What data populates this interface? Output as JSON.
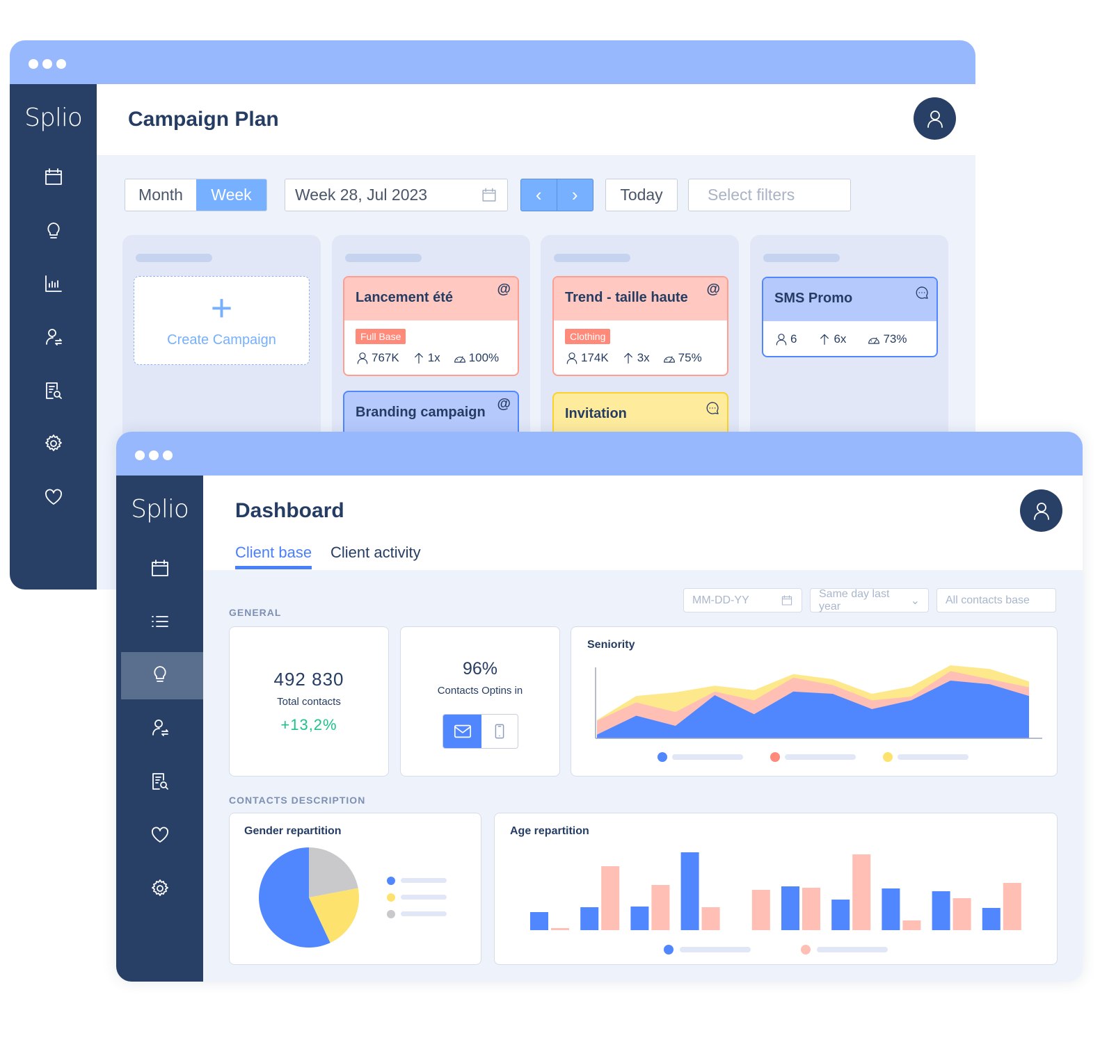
{
  "colors": {
    "navy": "#283f66",
    "titlebar": "#98b8fd",
    "accent": "#5087fe",
    "pink": "#ffbfb5",
    "yellow": "#fde98c",
    "green": "#1ec28b",
    "tag": "#ff8a7a"
  },
  "campaign_window": {
    "logo": "Splio",
    "sidebar_icons": [
      "calendar-icon",
      "lightbulb-icon",
      "bar-chart-icon",
      "user-sync-icon",
      "report-search-icon",
      "gear-icon",
      "heart-icon"
    ],
    "title": "Campaign Plan",
    "view_toggle": {
      "month": "Month",
      "week": "Week",
      "selected": "Week"
    },
    "week_field": "Week 28, Jul 2023",
    "today": "Today",
    "filters_placeholder": "Select filters",
    "create_campaign": "Create Campaign",
    "cards": [
      {
        "title": "Lancement été",
        "channel": "email",
        "tag": "Full Base",
        "audience": "767K",
        "multiplier": "1x",
        "score": "100%"
      },
      {
        "title": "Branding campaign",
        "channel": "email"
      },
      {
        "title": "Trend - taille haute",
        "channel": "email",
        "tag": "Clothing",
        "audience": "174K",
        "multiplier": "3x",
        "score": "75%"
      },
      {
        "title": "Invitation",
        "channel": "sms"
      },
      {
        "title": "SMS Promo",
        "channel": "sms",
        "audience": "6",
        "multiplier": "6x",
        "score": "73%"
      }
    ]
  },
  "dashboard_window": {
    "logo": "Splio",
    "sidebar_icons": [
      "calendar-icon",
      "list-icon",
      "lightbulb-icon",
      "user-sync-icon",
      "report-search-icon",
      "heart-icon",
      "gear-icon"
    ],
    "active_sidebar": "lightbulb-icon",
    "title": "Dashboard",
    "tabs": [
      {
        "label": "Client base",
        "active": true
      },
      {
        "label": "Client activity",
        "active": false
      }
    ],
    "filters": {
      "date_placeholder": "MM-DD-YY",
      "compare": "Same day last year",
      "base": "All contacts base"
    },
    "general_label": "GENERAL",
    "total_contacts": {
      "value": "492 830",
      "label": "Total contacts",
      "change": "+13,2%"
    },
    "optins": {
      "value": "96%",
      "label": "Contacts Optins in",
      "selected_channel": "email"
    },
    "contacts_description_label": "CONTACTS DESCRIPTION"
  },
  "chart_data": [
    {
      "type": "area",
      "title": "Seniority",
      "stacked": true,
      "grid": false,
      "series": [
        {
          "color": "#5087fe",
          "values": [
            5,
            31,
            17,
            59,
            33,
            64,
            61,
            40,
            52,
            79,
            74,
            58
          ]
        },
        {
          "color": "#ffbfb5",
          "values": [
            24,
            49,
            36,
            64,
            52,
            83,
            73,
            52,
            57,
            92,
            81,
            70
          ]
        },
        {
          "color": "#fde98c",
          "values": [
            25,
            58,
            63,
            72,
            66,
            88,
            81,
            61,
            71,
            100,
            95,
            78
          ]
        }
      ]
    },
    {
      "type": "pie",
      "title": "Gender repartition",
      "slices": [
        {
          "color": "#c9c9cc",
          "value": 22
        },
        {
          "color": "#fde26e",
          "value": 21
        },
        {
          "color": "#5087fe",
          "value": 57
        }
      ]
    },
    {
      "type": "bar",
      "title": "Age repartition",
      "series": [
        {
          "color": "#5087fe",
          "values": [
            26,
            33,
            34,
            112,
            0,
            63,
            44,
            60,
            56,
            32
          ]
        },
        {
          "color": "#ffbfb5",
          "values": [
            3,
            92,
            65,
            33,
            58,
            61,
            109,
            14,
            46,
            68
          ]
        }
      ]
    }
  ]
}
